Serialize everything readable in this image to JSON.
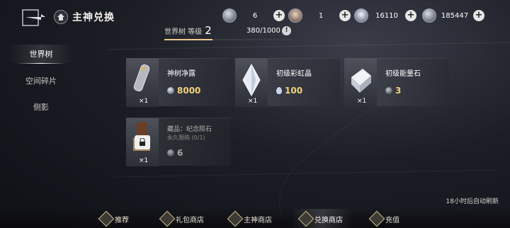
{
  "header": {
    "title": "主神兑换",
    "resources": [
      {
        "icon": "silver-coin-icon",
        "value": "6"
      },
      {
        "icon": "avatar-token-icon",
        "value": "1"
      },
      {
        "icon": "water-drop-icon",
        "value": "16110"
      },
      {
        "icon": "crystal-coin-icon",
        "value": "185447"
      }
    ]
  },
  "level": {
    "label": "世界树 等级",
    "value": "2",
    "exp": "380/1000",
    "progress": 0.38
  },
  "nav": [
    "世界树",
    "空间碎片",
    "侧影"
  ],
  "items": [
    {
      "name": "神树净露",
      "qty": "×1",
      "price": "8000",
      "currency": "crystal-coin-icon"
    },
    {
      "name": "初级彩虹晶",
      "qty": "×1",
      "price": "100",
      "currency": "water-drop-icon"
    },
    {
      "name": "初级能量石",
      "qty": "×1",
      "price": "3",
      "currency": "silver-coin-icon"
    },
    {
      "name": "藏品：纪念陨石",
      "qty": "×1",
      "limit": "永久限购 (0/1)",
      "price": "6",
      "currency": "silver-coin-icon"
    }
  ],
  "refresh_note": "18小时后自动刷新",
  "tabs": [
    "推荐",
    "礼包商店",
    "主神商店",
    "兑换商店",
    "充值"
  ],
  "colors": {
    "price": "#f3d27a",
    "accent": "#e9c98a"
  }
}
